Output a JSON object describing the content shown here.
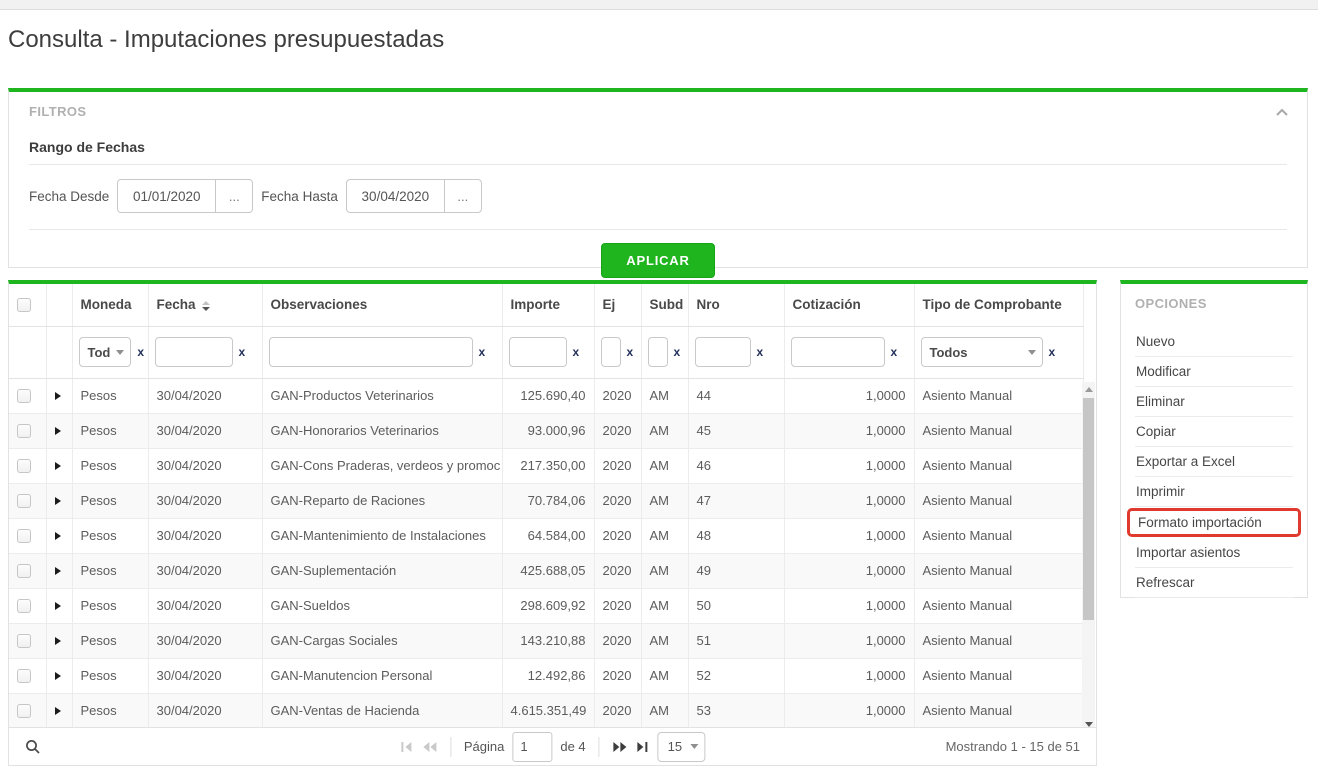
{
  "colors": {
    "accent_green": "#1fb51f",
    "highlight_red": "#e0392e"
  },
  "page": {
    "title": "Consulta - Imputaciones presupuestadas"
  },
  "filters": {
    "panel_title": "FILTROS",
    "section_title": "Rango de Fechas",
    "fecha_desde_label": "Fecha Desde",
    "fecha_desde_value": "01/01/2020",
    "fecha_hasta_label": "Fecha Hasta",
    "fecha_hasta_value": "30/04/2020",
    "picker_button_label": "...",
    "apply_button_label": "APLICAR"
  },
  "grid": {
    "columns": {
      "moneda": "Moneda",
      "fecha": "Fecha",
      "observaciones": "Observaciones",
      "importe": "Importe",
      "ej": "Ej",
      "subd": "Subd",
      "nro": "Nro",
      "cotizacion": "Cotización",
      "tipo": "Tipo de Comprobante"
    },
    "filter_row": {
      "moneda_selected": "Tod",
      "tipo_selected": "Todos",
      "clear_label": "x"
    },
    "rows": [
      {
        "moneda": "Pesos",
        "fecha": "30/04/2020",
        "observaciones": "GAN-Productos Veterinarios",
        "importe": "125.690,40",
        "ej": "2020",
        "subd": "AM",
        "nro": "44",
        "cotizacion": "1,0000",
        "tipo": "Asiento Manual"
      },
      {
        "moneda": "Pesos",
        "fecha": "30/04/2020",
        "observaciones": "GAN-Honorarios Veterinarios",
        "importe": "93.000,96",
        "ej": "2020",
        "subd": "AM",
        "nro": "45",
        "cotizacion": "1,0000",
        "tipo": "Asiento Manual"
      },
      {
        "moneda": "Pesos",
        "fecha": "30/04/2020",
        "observaciones": "GAN-Cons Praderas, verdeos y promoc",
        "importe": "217.350,00",
        "ej": "2020",
        "subd": "AM",
        "nro": "46",
        "cotizacion": "1,0000",
        "tipo": "Asiento Manual"
      },
      {
        "moneda": "Pesos",
        "fecha": "30/04/2020",
        "observaciones": "GAN-Reparto de Raciones",
        "importe": "70.784,06",
        "ej": "2020",
        "subd": "AM",
        "nro": "47",
        "cotizacion": "1,0000",
        "tipo": "Asiento Manual"
      },
      {
        "moneda": "Pesos",
        "fecha": "30/04/2020",
        "observaciones": "GAN-Mantenimiento de Instalaciones",
        "importe": "64.584,00",
        "ej": "2020",
        "subd": "AM",
        "nro": "48",
        "cotizacion": "1,0000",
        "tipo": "Asiento Manual"
      },
      {
        "moneda": "Pesos",
        "fecha": "30/04/2020",
        "observaciones": "GAN-Suplementación",
        "importe": "425.688,05",
        "ej": "2020",
        "subd": "AM",
        "nro": "49",
        "cotizacion": "1,0000",
        "tipo": "Asiento Manual"
      },
      {
        "moneda": "Pesos",
        "fecha": "30/04/2020",
        "observaciones": "GAN-Sueldos",
        "importe": "298.609,92",
        "ej": "2020",
        "subd": "AM",
        "nro": "50",
        "cotizacion": "1,0000",
        "tipo": "Asiento Manual"
      },
      {
        "moneda": "Pesos",
        "fecha": "30/04/2020",
        "observaciones": "GAN-Cargas Sociales",
        "importe": "143.210,88",
        "ej": "2020",
        "subd": "AM",
        "nro": "51",
        "cotizacion": "1,0000",
        "tipo": "Asiento Manual"
      },
      {
        "moneda": "Pesos",
        "fecha": "30/04/2020",
        "observaciones": "GAN-Manutencion Personal",
        "importe": "12.492,86",
        "ej": "2020",
        "subd": "AM",
        "nro": "52",
        "cotizacion": "1,0000",
        "tipo": "Asiento Manual"
      },
      {
        "moneda": "Pesos",
        "fecha": "30/04/2020",
        "observaciones": "GAN-Ventas de Hacienda",
        "importe": "4.615.351,49",
        "ej": "2020",
        "subd": "AM",
        "nro": "53",
        "cotizacion": "1,0000",
        "tipo": "Asiento Manual"
      }
    ]
  },
  "options": {
    "panel_title": "OPCIONES",
    "items": [
      {
        "label": "Nuevo"
      },
      {
        "label": "Modificar"
      },
      {
        "label": "Eliminar"
      },
      {
        "label": "Copiar"
      },
      {
        "label": "Exportar a Excel"
      },
      {
        "label": "Imprimir"
      },
      {
        "label": "Formato importación",
        "highlighted": true
      },
      {
        "label": "Importar asientos"
      },
      {
        "label": "Refrescar"
      }
    ]
  },
  "footer": {
    "page_label": "Página",
    "page_value": "1",
    "total_pages_label": "de 4",
    "page_size_value": "15",
    "status_text": "Mostrando 1 - 15 de 51"
  }
}
